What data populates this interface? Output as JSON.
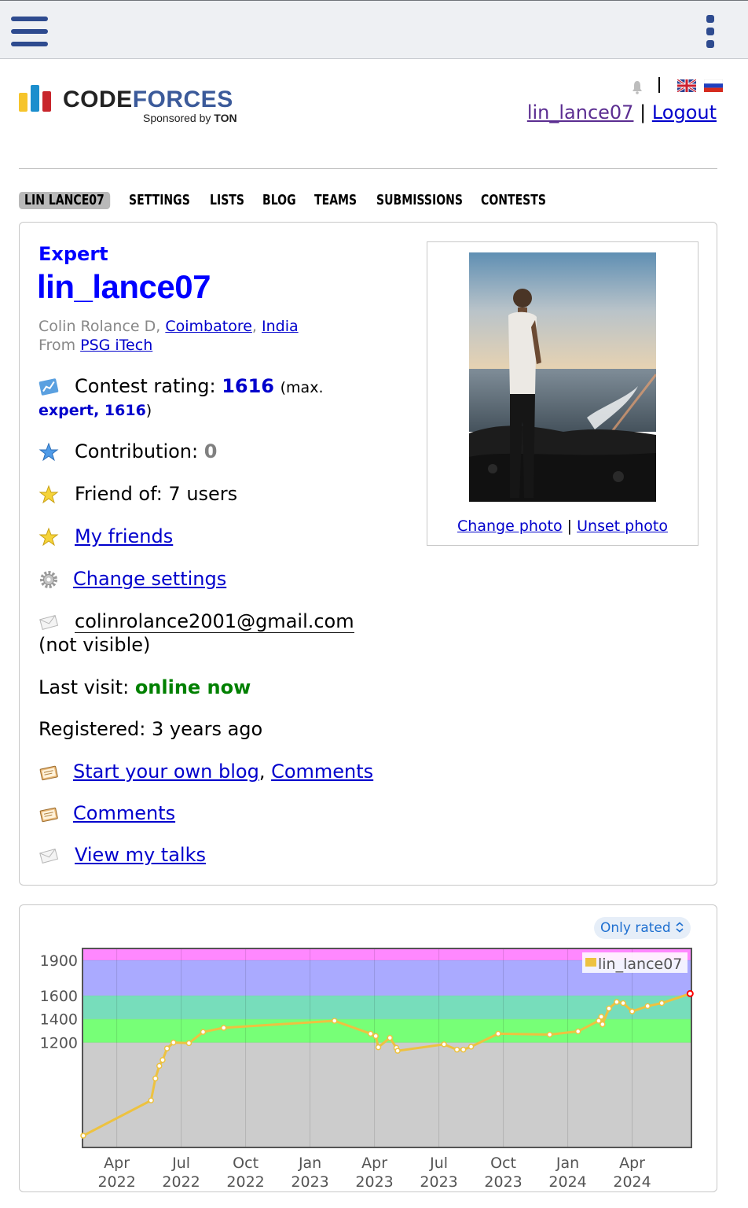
{
  "header": {
    "logo_text_a": "CODE",
    "logo_text_b": "FORCES",
    "sponsor_prefix": "Sponsored by",
    "sponsor_name": "TON",
    "user_link": "lin_lance07",
    "separator": "|",
    "logout": "Logout"
  },
  "tabs": [
    "LIN LANCE07",
    "SETTINGS",
    "LISTS",
    "BLOG",
    "TEAMS",
    "SUBMISSIONS",
    "CONTESTS"
  ],
  "profile": {
    "rank": "Expert",
    "handle": "lin_lance07",
    "name_prefix": "Colin Rolance D,",
    "city": "Coimbatore",
    "comma": ",",
    "country": "India",
    "from_label": "From",
    "organization": "PSG iTech",
    "rating_label": "Contest rating:",
    "rating_value": "1616",
    "rating_max_open": "(max.",
    "rating_max_value": "expert, 1616",
    "rating_max_close": ")",
    "contribution_label": "Contribution:",
    "contribution_value": "0",
    "friend_of": "Friend of: 7 users",
    "my_friends": "My friends",
    "change_settings": "Change settings",
    "email": "colinrolance2001@gmail.com",
    "email_note": "(not visible)",
    "last_visit_label": "Last visit:",
    "last_visit_value": "online now",
    "registered": "Registered: 3 years ago",
    "start_blog": "Start your own blog",
    "blog_comments": "Comments",
    "comments": "Comments",
    "view_talks": "View my talks",
    "change_photo": "Change photo",
    "photo_sep": "|",
    "unset_photo": "Unset photo"
  },
  "chart_controls": {
    "only_rated": "Only rated"
  },
  "colors": {
    "link": "#0000cc",
    "expert": "#0000ff",
    "online": "#008000",
    "line": "#edc240",
    "band_newbie": "#cccccc",
    "band_pupil": "#77ff77",
    "band_specialist": "#77ddbb",
    "band_expert": "#aaaaff",
    "band_cm": "#ff88ff"
  },
  "chart_data": {
    "type": "line",
    "legend": "lin_lance07",
    "legend_position": "top-right",
    "x_ticks": [
      {
        "month": "Apr",
        "year": "2022",
        "t": 2022.25
      },
      {
        "month": "Jul",
        "year": "2022",
        "t": 2022.5
      },
      {
        "month": "Oct",
        "year": "2022",
        "t": 2022.75
      },
      {
        "month": "Jan",
        "year": "2023",
        "t": 2023.0
      },
      {
        "month": "Apr",
        "year": "2023",
        "t": 2023.25
      },
      {
        "month": "Jul",
        "year": "2023",
        "t": 2023.5
      },
      {
        "month": "Oct",
        "year": "2023",
        "t": 2023.75
      },
      {
        "month": "Jan",
        "year": "2024",
        "t": 2024.0
      },
      {
        "month": "Apr",
        "year": "2024",
        "t": 2024.25
      }
    ],
    "y_ticks": [
      1200,
      1400,
      1600,
      1900
    ],
    "xlim": [
      2022.117,
      2024.48
    ],
    "ylim": [
      308,
      2000
    ],
    "bands": [
      {
        "from": 0,
        "to": 1200,
        "color": "#cccccc"
      },
      {
        "from": 1200,
        "to": 1400,
        "color": "#77ff77"
      },
      {
        "from": 1400,
        "to": 1600,
        "color": "#77ddbb"
      },
      {
        "from": 1600,
        "to": 1900,
        "color": "#aaaaff"
      },
      {
        "from": 1900,
        "to": 2100,
        "color": "#ff88ff"
      }
    ],
    "points": [
      {
        "t": 2022.12,
        "r": 408
      },
      {
        "t": 2022.383,
        "r": 708
      },
      {
        "t": 2022.4,
        "r": 895
      },
      {
        "t": 2022.415,
        "r": 1001
      },
      {
        "t": 2022.428,
        "r": 1052
      },
      {
        "t": 2022.445,
        "r": 1150
      },
      {
        "t": 2022.47,
        "r": 1200
      },
      {
        "t": 2022.53,
        "r": 1195
      },
      {
        "t": 2022.585,
        "r": 1290
      },
      {
        "t": 2022.665,
        "r": 1325
      },
      {
        "t": 2023.095,
        "r": 1385
      },
      {
        "t": 2023.235,
        "r": 1275
      },
      {
        "t": 2023.255,
        "r": 1255
      },
      {
        "t": 2023.265,
        "r": 1160
      },
      {
        "t": 2023.31,
        "r": 1240
      },
      {
        "t": 2023.335,
        "r": 1155
      },
      {
        "t": 2023.34,
        "r": 1130
      },
      {
        "t": 2023.52,
        "r": 1185
      },
      {
        "t": 2023.57,
        "r": 1140
      },
      {
        "t": 2023.595,
        "r": 1140
      },
      {
        "t": 2023.625,
        "r": 1165
      },
      {
        "t": 2023.73,
        "r": 1275
      },
      {
        "t": 2023.93,
        "r": 1268
      },
      {
        "t": 2024.04,
        "r": 1295
      },
      {
        "t": 2024.12,
        "r": 1385
      },
      {
        "t": 2024.13,
        "r": 1420
      },
      {
        "t": 2024.135,
        "r": 1355
      },
      {
        "t": 2024.16,
        "r": 1490
      },
      {
        "t": 2024.19,
        "r": 1545
      },
      {
        "t": 2024.215,
        "r": 1535
      },
      {
        "t": 2024.25,
        "r": 1465
      },
      {
        "t": 2024.31,
        "r": 1510
      },
      {
        "t": 2024.365,
        "r": 1535
      },
      {
        "t": 2024.475,
        "r": 1616
      }
    ]
  }
}
